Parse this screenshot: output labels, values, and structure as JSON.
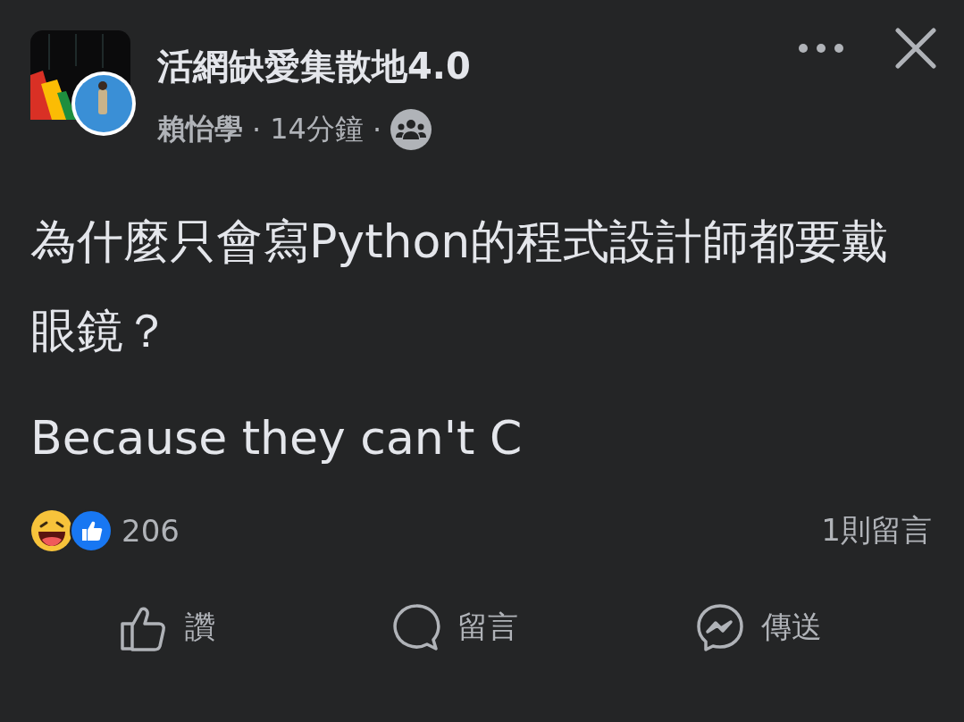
{
  "header": {
    "group": "活網缺愛集散地4.0",
    "author": "賴怡學",
    "separator_1": "·",
    "time": "14分鐘",
    "separator_2": "·"
  },
  "post": {
    "lines": [
      "為什麼只會寫Python的程式設計師都要戴眼鏡？",
      "Because they can't C"
    ]
  },
  "stats": {
    "count": "206",
    "comments": "1則留言"
  },
  "actions": [
    {
      "kind": "like",
      "label": "讚"
    },
    {
      "kind": "comment",
      "label": "留言"
    },
    {
      "kind": "share",
      "label": "傳送"
    }
  ]
}
